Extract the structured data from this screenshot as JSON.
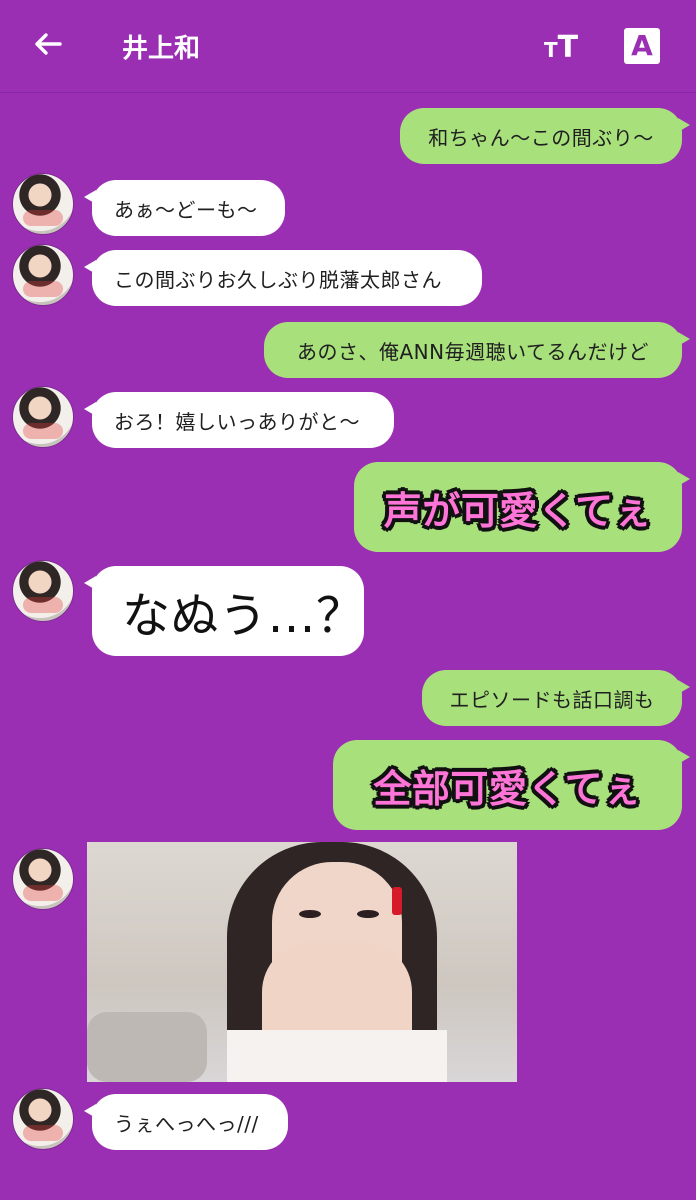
{
  "header": {
    "title": "井上和",
    "font_size_icon_label_small": "T",
    "font_size_icon_label_big": "T",
    "translate_label": "A"
  },
  "messages": [
    {
      "from": "me",
      "text": "和ちゃん〜この間ぶり〜"
    },
    {
      "from": "them",
      "text": "あぁ〜どーも〜"
    },
    {
      "from": "them",
      "text": "この間ぶりお久しぶり脱藩太郎さん"
    },
    {
      "from": "me",
      "text": "あのさ、俺ANN毎週聴いてるんだけど"
    },
    {
      "from": "them",
      "text": "おろ！嬉しいっありがと〜"
    },
    {
      "from": "me",
      "text": "声が可愛くてぇ"
    },
    {
      "from": "them",
      "text": "なぬう…？"
    },
    {
      "from": "me",
      "text": "エピソードも話口調も"
    },
    {
      "from": "me",
      "text": "全部可愛くてぇ"
    },
    {
      "from": "them",
      "type": "photo"
    },
    {
      "from": "them",
      "text": "うぇへっへっ///"
    }
  ],
  "colors": {
    "background": "#9a2fb4",
    "my_bubble": "#a8e07c",
    "their_bubble": "#ffffff",
    "emphasis_text": "#ff74d7"
  }
}
